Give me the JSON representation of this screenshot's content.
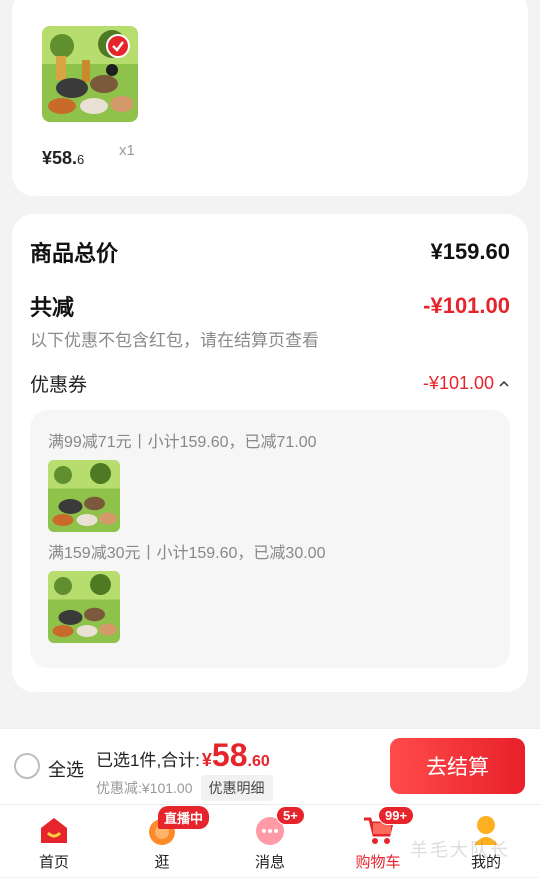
{
  "product": {
    "price_yen": "¥",
    "price_int": "58.",
    "price_dec": "6",
    "qty": "x1"
  },
  "summary": {
    "total_label": "商品总价",
    "total_value": "¥159.60",
    "reduce_label": "共减",
    "reduce_value": "-¥101.00",
    "note": "以下优惠不包含红包，请在结算页查看",
    "coupon_label": "优惠券",
    "coupon_value": "-¥101.00"
  },
  "coupons": [
    {
      "text": "满99减71元丨小计159.60，已减71.00"
    },
    {
      "text": "满159减30元丨小计159.60，已减30.00"
    }
  ],
  "checkout": {
    "select_all": "全选",
    "selected_text": "已选1件,合计:",
    "yen": "¥",
    "amount_int": "58",
    "amount_dec": ".60",
    "discount_text": "优惠减:¥101.00",
    "discount_detail": "优惠明细",
    "button": "去结算"
  },
  "tabs": [
    {
      "label": "首页",
      "icon": "home-icon"
    },
    {
      "label": "逛",
      "icon": "browse-icon"
    },
    {
      "label": "消息",
      "icon": "message-icon"
    },
    {
      "label": "购物车",
      "icon": "cart-icon"
    },
    {
      "label": "我的",
      "icon": "profile-icon"
    }
  ],
  "badges": {
    "live": "直播中",
    "messages": "5+",
    "cart": "99+"
  },
  "watermark": "羊毛大队长",
  "colors": {
    "accent": "#e6242b"
  }
}
